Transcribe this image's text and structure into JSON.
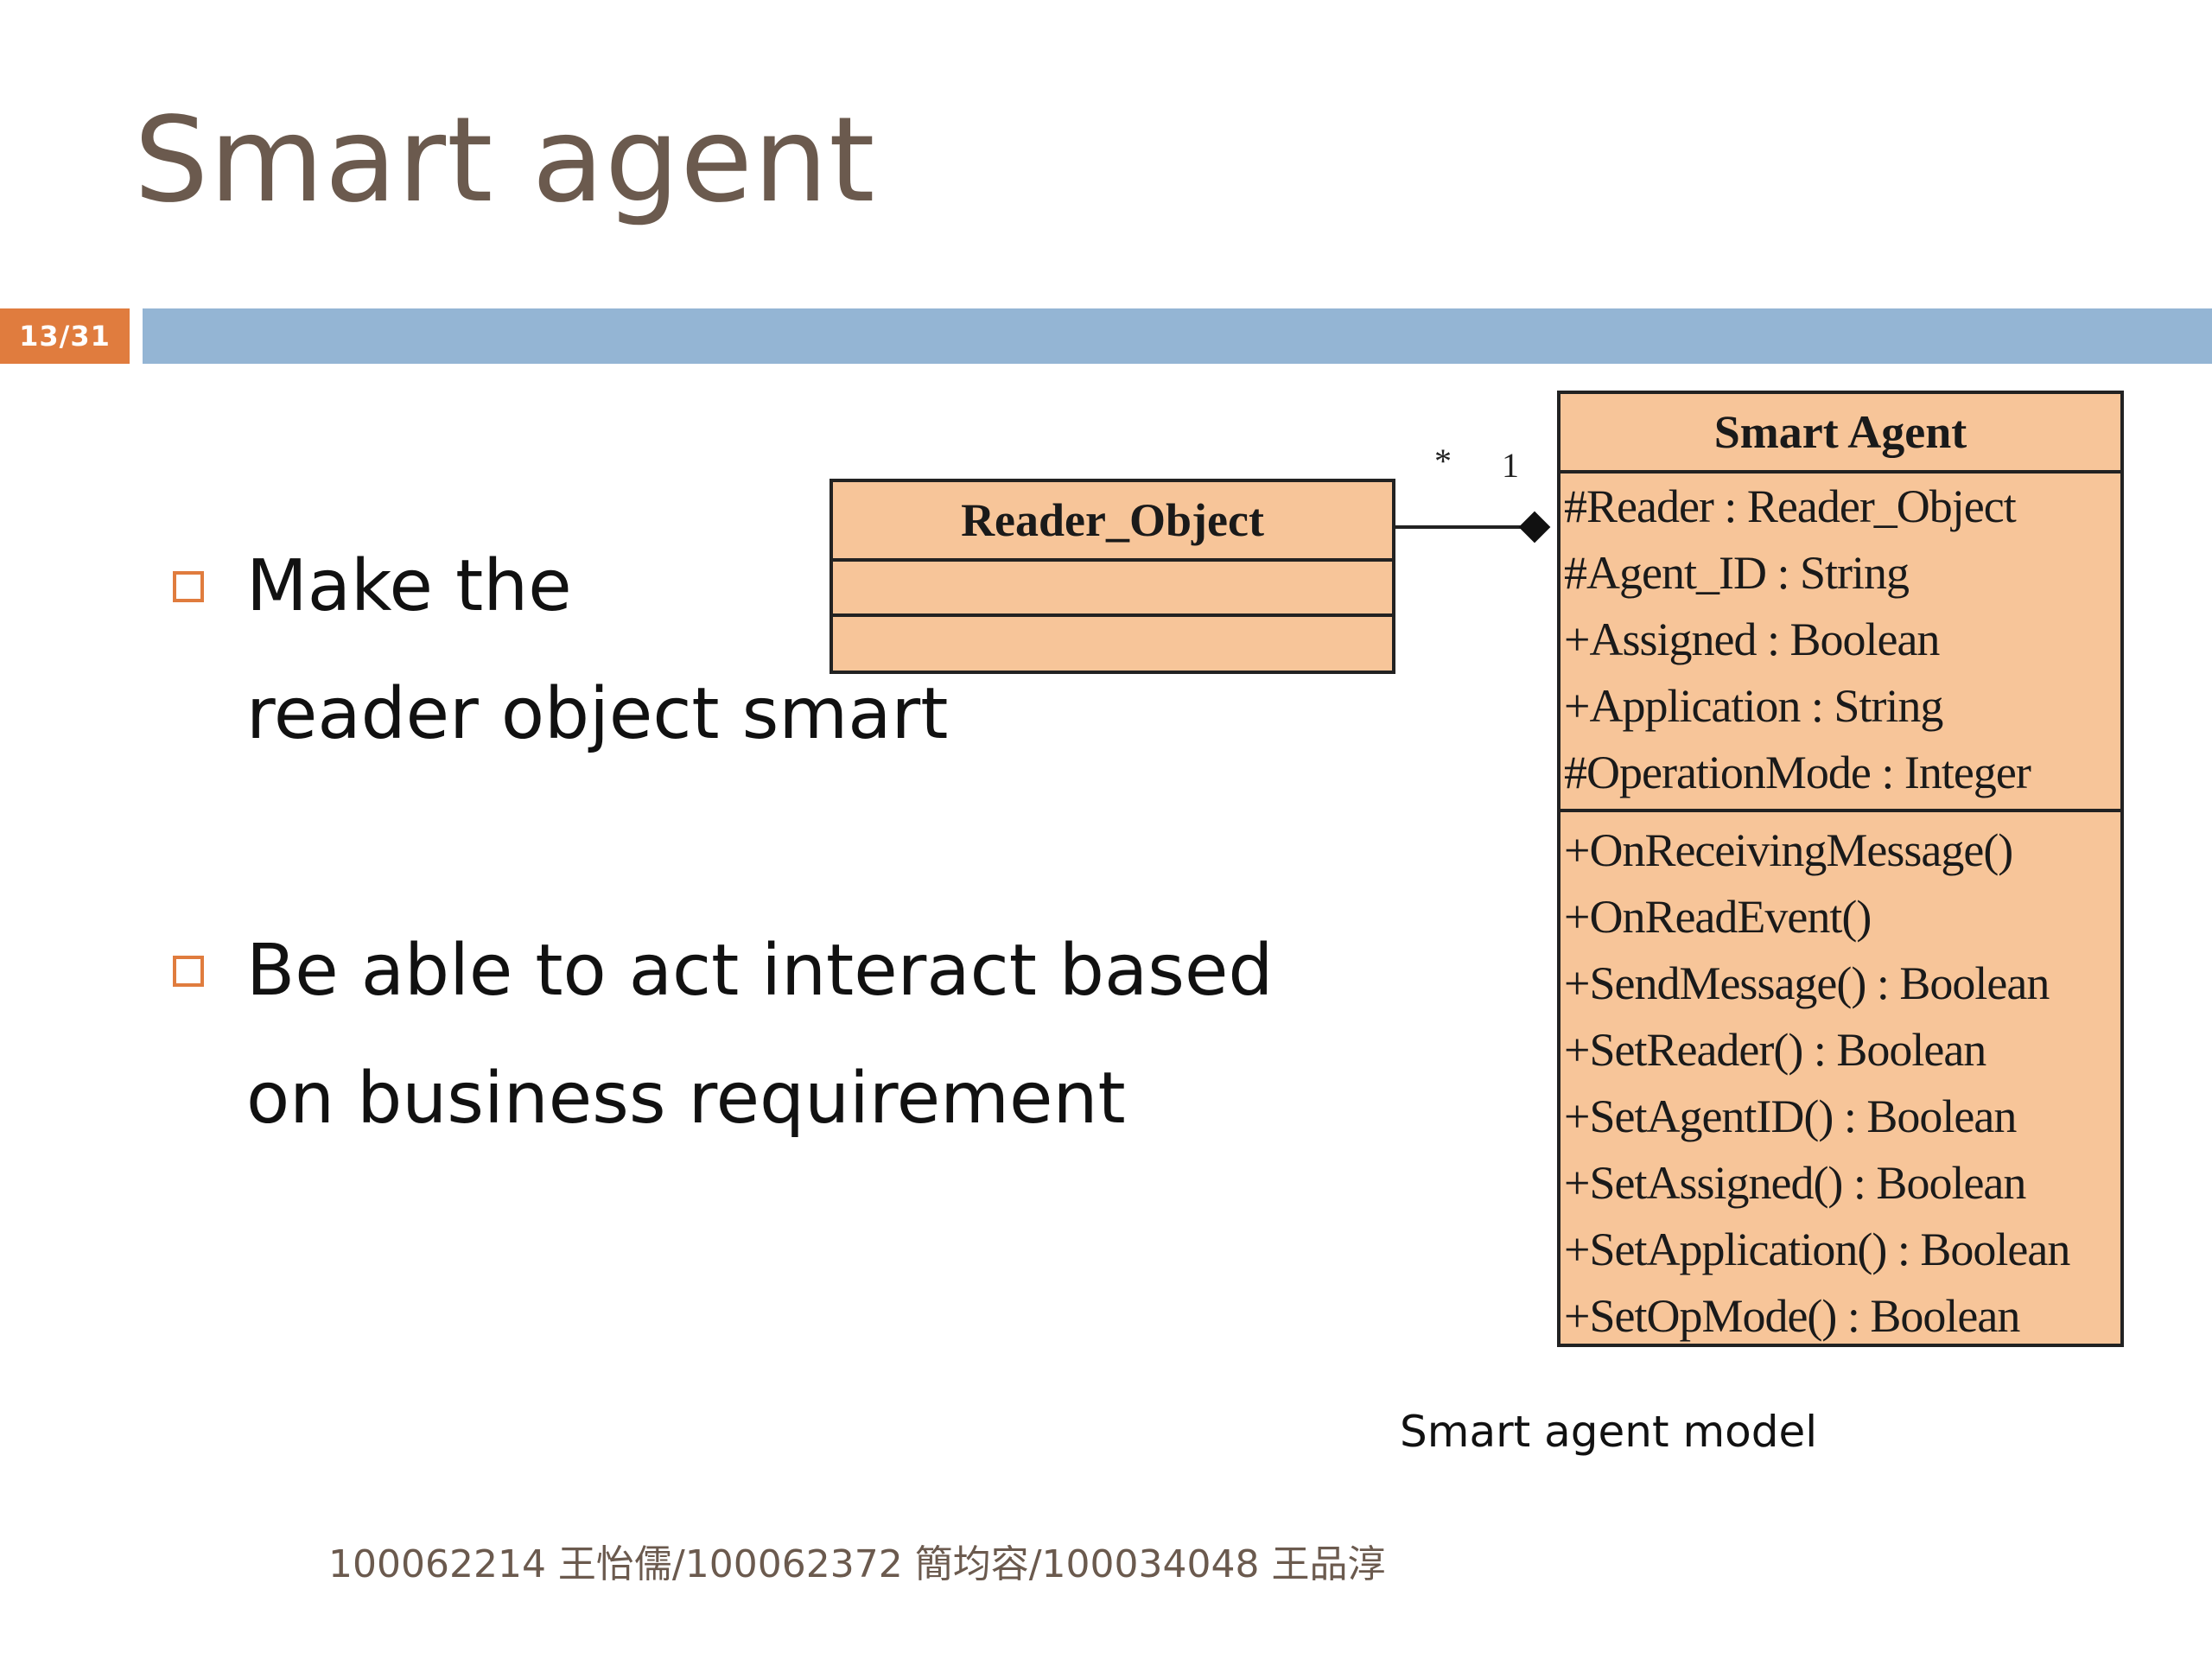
{
  "slide": {
    "title": "Smart agent",
    "page_indicator": "13/31",
    "accent_color": "#e07c3e",
    "bar_color": "#94b5d4"
  },
  "bullets": [
    {
      "line1": "Make the",
      "line2": "reader object smart"
    },
    {
      "line1": "Be able to act interact based",
      "line2": "on business requirement"
    }
  ],
  "diagram": {
    "reader_object": {
      "name": "Reader_Object"
    },
    "smart_agent": {
      "name": "Smart Agent",
      "attributes": [
        "#Reader : Reader_Object",
        "#Agent_ID : String",
        "+Assigned : Boolean",
        "+Application : String",
        "#OperationMode : Integer"
      ],
      "operations": [
        "+OnReceivingMessage()",
        "+OnReadEvent()",
        "+SendMessage() : Boolean",
        "+SetReader() : Boolean",
        "+SetAgentID() : Boolean",
        "+SetAssigned() : Boolean",
        "+SetApplication() : Boolean",
        "+SetOpMode() : Boolean"
      ]
    },
    "multiplicity_reader": "*",
    "multiplicity_agent": "1",
    "fill_color": "#f7c599",
    "caption": "Smart agent model"
  },
  "footer": "100062214 王怡儒/100062372 簡均容/100034048 王品淳"
}
